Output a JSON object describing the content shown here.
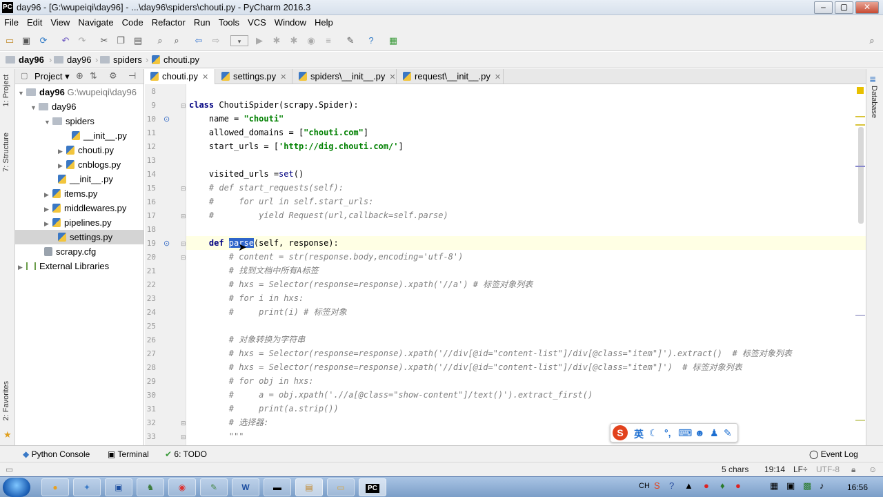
{
  "window": {
    "title": "day96 - [G:\\wupeiqi\\day96] - ...\\day96\\spiders\\chouti.py - PyCharm 2016.3",
    "app_icon": "PC",
    "controls": [
      "–",
      "▢",
      "✕"
    ]
  },
  "menu": [
    "File",
    "Edit",
    "View",
    "Navigate",
    "Code",
    "Refactor",
    "Run",
    "Tools",
    "VCS",
    "Window",
    "Help"
  ],
  "breadcrumb": [
    "day96",
    "day96",
    "spiders",
    "chouti.py"
  ],
  "side_tabs": {
    "project": "1: Project",
    "structure": "7: Structure",
    "favorites": "2: Favorites",
    "database": "Database"
  },
  "project_panel": {
    "header_label": "Project",
    "tree": [
      {
        "label": "day96",
        "path": "G:\\wupeiqi\\day96",
        "type": "folder",
        "arrow": "▼"
      },
      {
        "label": "day96",
        "type": "folder",
        "arrow": "▼"
      },
      {
        "label": "spiders",
        "type": "folder",
        "arrow": "▼"
      },
      {
        "label": "__init__.py",
        "type": "py",
        "arrow": ""
      },
      {
        "label": "chouti.py",
        "type": "py",
        "arrow": "▶"
      },
      {
        "label": "cnblogs.py",
        "type": "py",
        "arrow": "▶"
      },
      {
        "label": "__init__.py",
        "type": "py",
        "arrow": ""
      },
      {
        "label": "items.py",
        "type": "py",
        "arrow": "▶"
      },
      {
        "label": "middlewares.py",
        "type": "py",
        "arrow": "▶"
      },
      {
        "label": "pipelines.py",
        "type": "py",
        "arrow": "▶"
      },
      {
        "label": "settings.py",
        "type": "py",
        "arrow": ""
      },
      {
        "label": "scrapy.cfg",
        "type": "cfg",
        "arrow": ""
      },
      {
        "label": "External Libraries",
        "type": "lib",
        "arrow": "▶"
      }
    ]
  },
  "editor_tabs": [
    "chouti.py",
    "settings.py",
    "spiders\\__init__.py",
    "request\\__init__.py"
  ],
  "code": {
    "line_numbers": [
      "8",
      "9",
      "10",
      "11",
      "12",
      "13",
      "14",
      "15",
      "16",
      "17",
      "18",
      "19",
      "20",
      "21",
      "22",
      "23",
      "24",
      "25",
      "26",
      "27",
      "28",
      "29",
      "30",
      "31",
      "32",
      "33"
    ],
    "l9_kw": "class",
    "l9_rest": " ChoutiSpider(scrapy.Spider):",
    "l10_a": "    name = ",
    "l10_s": "\"chouti\"",
    "l11_a": "    allowed_domains = [",
    "l11_s": "\"chouti.com\"",
    "l11_b": "]",
    "l12_a": "    start_urls = [",
    "l12_s": "'http://dig.chouti.com/'",
    "l12_b": "]",
    "l14_a": "    visited_urls =",
    "l14_f": "set",
    "l14_b": "()",
    "l15": "    # def start_requests(self):",
    "l16": "    #     for url in self.start_urls:",
    "l17": "    #         yield Request(url,callback=self.parse)",
    "l19_kw": "    def ",
    "l19_sel": "parse",
    "l19_rest": "(self, response):",
    "l20": "        # content = str(response.body,encoding='utf-8')",
    "l21": "        # 找到文档中所有A标签",
    "l22": "        # hxs = Selector(response=response).xpath('//a') # 标签对象列表",
    "l23": "        # for i in hxs:",
    "l24": "        #     print(i) # 标签对象",
    "l26": "        # 对象转换为字符串",
    "l27": "        # hxs = Selector(response=response).xpath('//div[@id=\"content-list\"]/div[@class=\"item\"]').extract()  # 标签对象列表",
    "l28": "        # hxs = Selector(response=response).xpath('//div[@id=\"content-list\"]/div[@class=\"item\"]')  # 标签对象列表",
    "l29": "        # for obj in hxs:",
    "l30": "        #     a = obj.xpath('.//a[@class=\"show-content\"]/text()').extract_first()",
    "l31": "        #     print(a.strip())",
    "l32": "        # 选择器:",
    "l33": "        \"\"\""
  },
  "tool_windows": {
    "python_console": "Python Console",
    "terminal": "Terminal",
    "todo": "6: TODO",
    "event_log": "Event Log"
  },
  "status": {
    "chars": "5 chars",
    "position": "19:14",
    "line_sep": "LF÷",
    "encoding": "UTF-8"
  },
  "ime": {
    "lang": "英"
  },
  "taskbar": {
    "tray_lang": "CH",
    "clock": "16:56"
  },
  "colors": {
    "keyword": "#000080",
    "string": "#008000",
    "comment": "#808080",
    "selection": "#2f65ca",
    "current_line": "#ffffe4"
  }
}
